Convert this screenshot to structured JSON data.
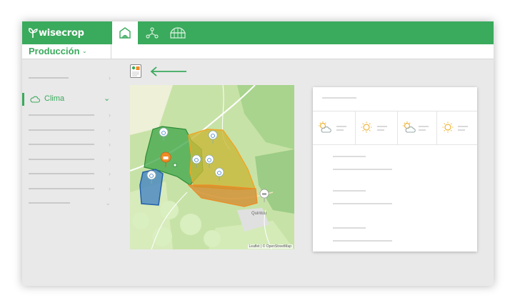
{
  "app": {
    "brand": "wisecrop"
  },
  "nav_tabs": [
    {
      "icon": "field-icon",
      "active": true
    },
    {
      "icon": "network-icon",
      "active": false
    },
    {
      "icon": "greenhouse-icon",
      "active": false
    }
  ],
  "section": {
    "label": "Producción",
    "chevron": "chevron-down-icon"
  },
  "sidebar": {
    "active_item": {
      "label": "Clima",
      "icon": "cloud-icon"
    }
  },
  "map": {
    "attribution": "Leaflet | © OpenStreetMap",
    "town_label": "Quintou"
  },
  "colors": {
    "brand": "#3aaa5c",
    "accent": "#f08a24",
    "parcel_yellow": "#c9b93a",
    "parcel_blue": "#3e7fc4"
  },
  "weather": {
    "icons": [
      "partly-cloudy-icon",
      "sun-icon",
      "partly-cloudy-icon",
      "sun-icon"
    ]
  }
}
